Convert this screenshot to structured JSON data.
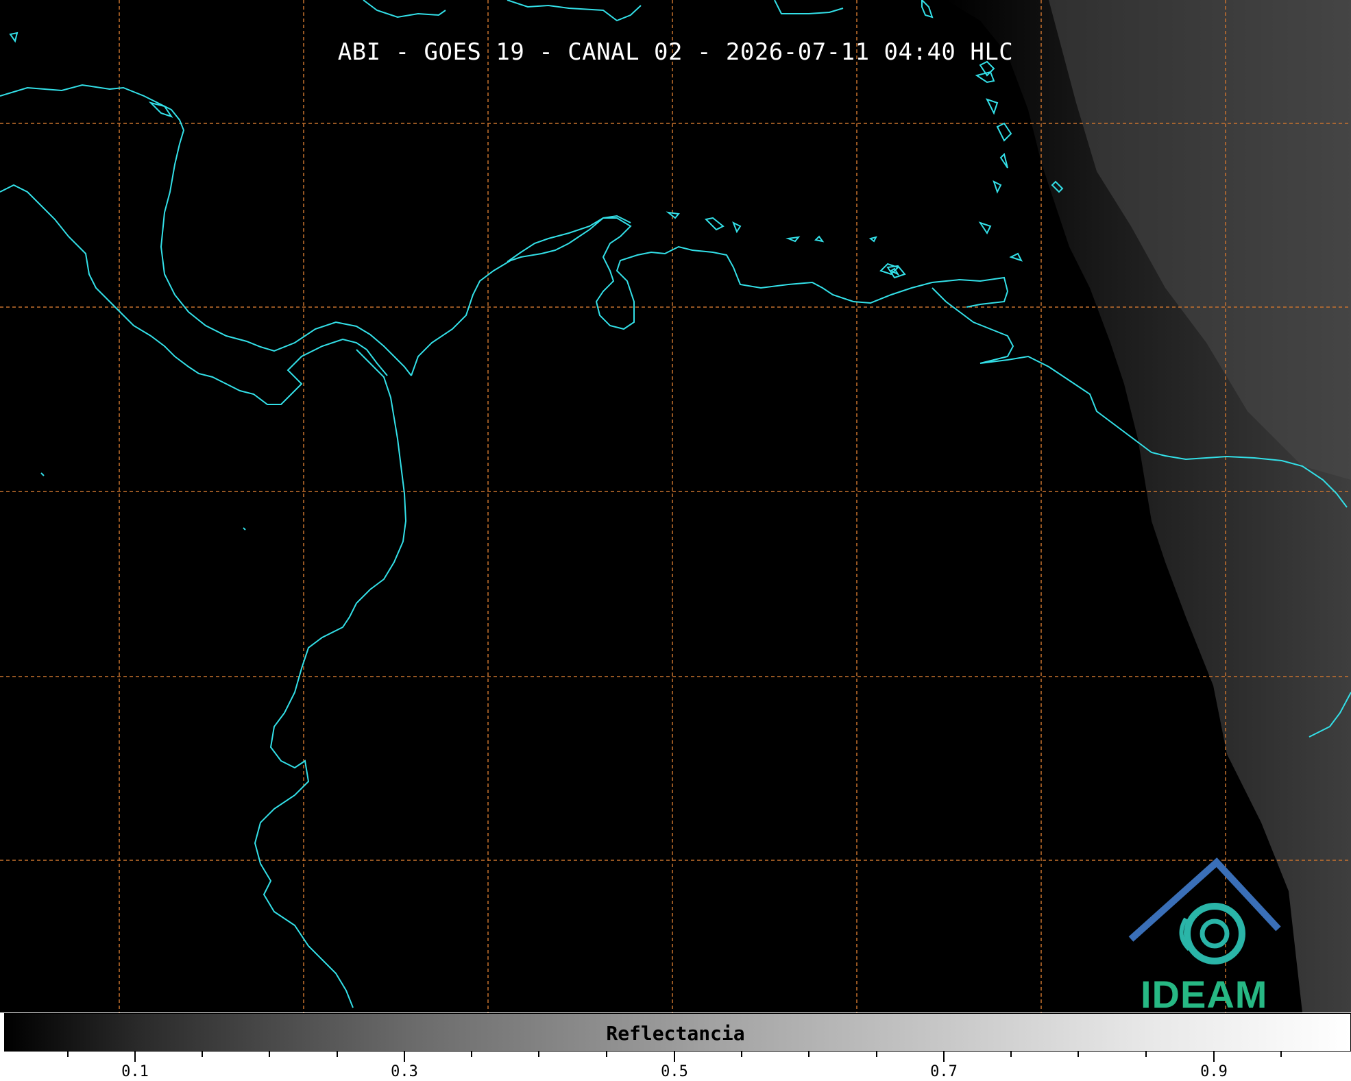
{
  "title": "ABI - GOES 19 - CANAL 02 - 2026-07-11 04:40 HLC",
  "colorbar": {
    "label": "Reflectancia",
    "ticks": [
      "0.1",
      "0.3",
      "0.5",
      "0.7",
      "0.9"
    ],
    "range": [
      0.0,
      1.0
    ]
  },
  "logo": {
    "text": "IDEAM",
    "colors": {
      "roof": "#3a6fb8",
      "swirl": "#2ab5a8",
      "text": "#27b884"
    }
  },
  "colors": {
    "coastline": "#33e0e8",
    "gridline": "#c8722e",
    "background": "#000000"
  },
  "grid": {
    "vertical_count": 7,
    "horizontal_count": 5,
    "style": "dashed"
  }
}
